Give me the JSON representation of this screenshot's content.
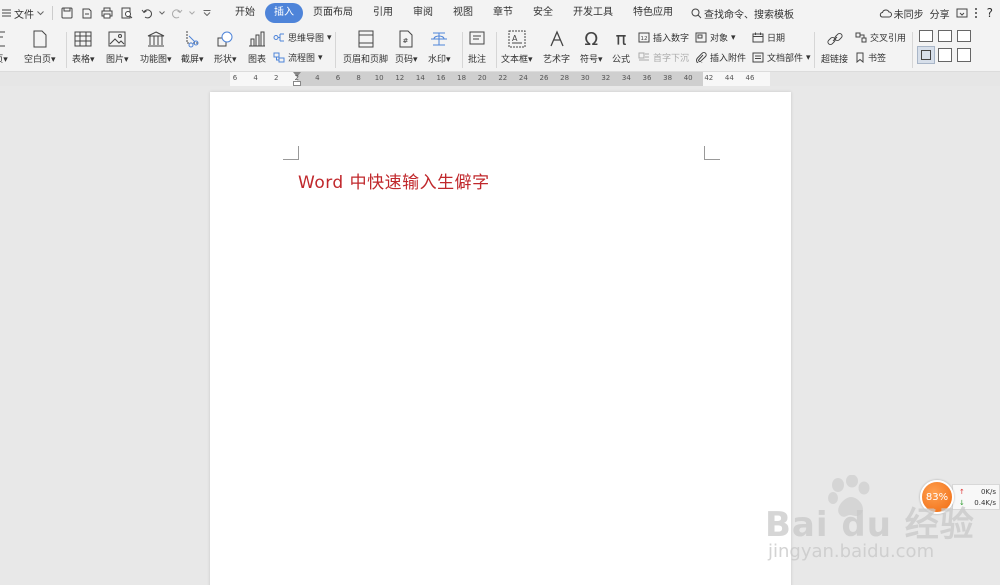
{
  "menubar": {
    "file_label": "文件",
    "tabs": [
      {
        "label": "开始",
        "active": false
      },
      {
        "label": "插入",
        "active": true
      },
      {
        "label": "页面布局",
        "active": false
      },
      {
        "label": "引用",
        "active": false
      },
      {
        "label": "审阅",
        "active": false
      },
      {
        "label": "视图",
        "active": false
      },
      {
        "label": "章节",
        "active": false
      },
      {
        "label": "安全",
        "active": false
      },
      {
        "label": "开发工具",
        "active": false
      },
      {
        "label": "特色应用",
        "active": false
      }
    ],
    "search_label": "查找命令、搜索模板",
    "sync_label": "未同步",
    "share_label": "分享",
    "help_label": "?",
    "accent_color": "#4e84d9"
  },
  "ribbon": {
    "page_label": "页",
    "blank_page_label": "空白页",
    "table_label": "表格",
    "picture_label": "图片",
    "function_chart_label": "功能图",
    "screenshot_label": "截屏",
    "shapes_label": "形状",
    "chart_label": "图表",
    "mindmap_label": "思维导图",
    "flowchart_label": "流程图",
    "header_footer_label": "页眉和页脚",
    "page_number_label": "页码",
    "watermark_label": "水印",
    "comment_label": "批注",
    "textbox_label": "文本框",
    "wordart_label": "艺术字",
    "symbol_label": "符号",
    "formula_label": "公式",
    "insert_number_label": "插入数字",
    "dropcap_label": "首字下沉",
    "object_label": "对象",
    "attachment_label": "插入附件",
    "date_label": "日期",
    "doc_parts_label": "文档部件",
    "hyperlink_label": "超链接",
    "crossref_label": "交叉引用",
    "bookmark_label": "书签"
  },
  "ruler": {
    "marks": [
      "6",
      "4",
      "2",
      "2",
      "4",
      "6",
      "8",
      "10",
      "12",
      "14",
      "16",
      "18",
      "20",
      "22",
      "24",
      "26",
      "28",
      "30",
      "32",
      "34",
      "36",
      "38",
      "40",
      "42",
      "44",
      "46"
    ]
  },
  "document": {
    "title": "Word  中快速输入生僻字",
    "title_color": "#c0282c"
  },
  "speed_widget": {
    "percent": "83%",
    "upload": "0K/s",
    "download": "0.4K/s"
  },
  "watermark": {
    "logo_text": "Bai  du 经验",
    "url": "jingyan.baidu.com"
  }
}
